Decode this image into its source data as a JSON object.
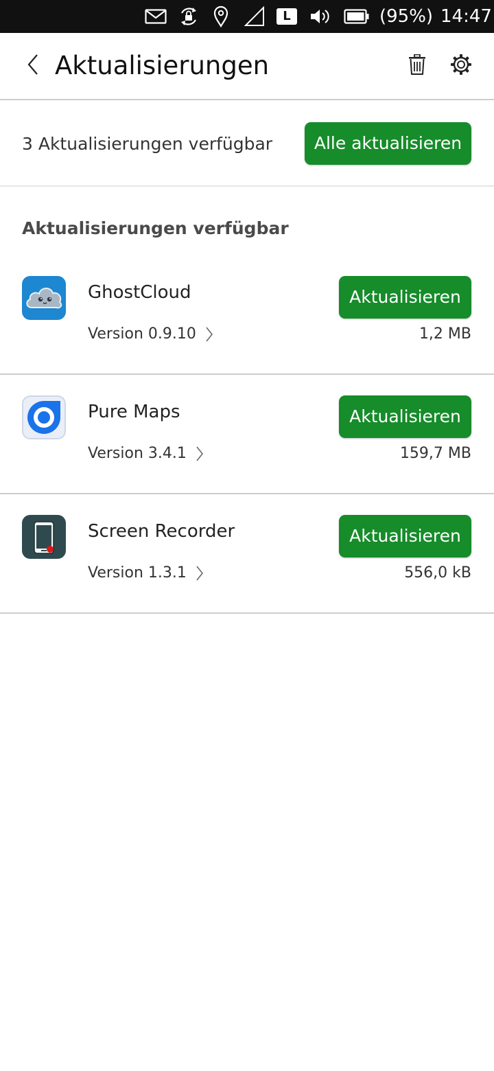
{
  "status_bar": {
    "icons": [
      "mail-icon",
      "rotation-lock-icon",
      "location-icon",
      "signal-icon",
      "lte-icon",
      "volume-icon",
      "battery-icon"
    ],
    "network_label": "L",
    "battery_text": "(95%)",
    "time": "14:47"
  },
  "header": {
    "title": "Aktualisierungen",
    "back_icon": "chevron-left-icon",
    "trash_icon": "trash-icon",
    "settings_icon": "gear-icon"
  },
  "summary": {
    "text": "3 Aktualisierungen verfügbar",
    "update_all_label": "Alle aktualisieren"
  },
  "section": {
    "heading": "Aktualisierungen verfügbar"
  },
  "apps": [
    {
      "name": "GhostCloud",
      "version": "Version 0.9.10",
      "size": "1,2 MB",
      "button_label": "Aktualisieren",
      "icon": "ghostcloud-icon"
    },
    {
      "name": "Pure Maps",
      "version": "Version 3.4.1",
      "size": "159,7 MB",
      "button_label": "Aktualisieren",
      "icon": "pure-maps-icon"
    },
    {
      "name": "Screen Recorder",
      "version": "Version 1.3.1",
      "size": "556,0 kB",
      "button_label": "Aktualisieren",
      "icon": "screen-recorder-icon"
    }
  ],
  "colors": {
    "accent_green": "#168c2a",
    "status_bar_bg": "#111111",
    "divider": "#cdcdcd"
  }
}
